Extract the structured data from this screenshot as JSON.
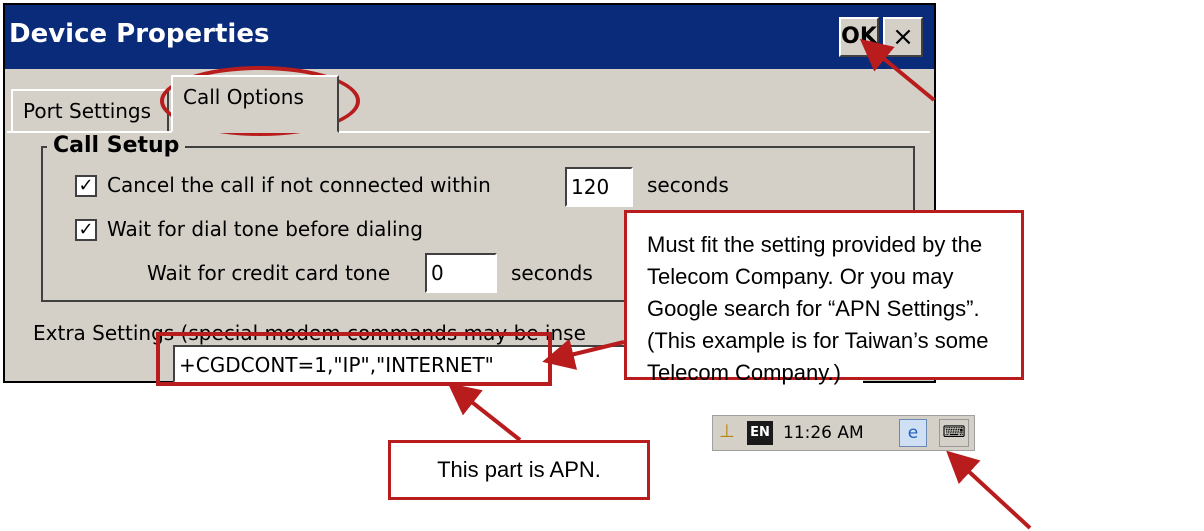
{
  "dialog": {
    "title": "Device Properties",
    "ok_label": "OK",
    "close_label": "×",
    "tabs": [
      {
        "label": "Port Settings"
      },
      {
        "label": "Call Options"
      }
    ],
    "call_setup": {
      "title": "Call Setup",
      "cancel_checked": true,
      "cancel_label": "Cancel the call if not connected within",
      "cancel_value": "120",
      "cancel_unit": "seconds",
      "wait_checked": true,
      "wait_label": "Wait for dial tone before dialing",
      "credit_label": "Wait for credit card tone",
      "credit_value": "0",
      "credit_unit": "seconds"
    },
    "extra_settings_label": "Extra Settings (special modem commands may be inse",
    "extra_settings_value": "+CGDCONT=1,\"IP\",\"INTERNET\""
  },
  "callouts": {
    "apn_note": "Must fit the setting provided by the Telecom Company. Or you may Google search for “APN Settings”. (This example is for Taiwan’s some Telecom Company.)",
    "apn_part": "This part is APN."
  },
  "taskbar": {
    "lang": "EN",
    "time": "11:26 AM"
  },
  "colors": {
    "annotation": "#b91c1c",
    "titlebar": "#0a2a7a",
    "window": "#d4d0c8"
  }
}
